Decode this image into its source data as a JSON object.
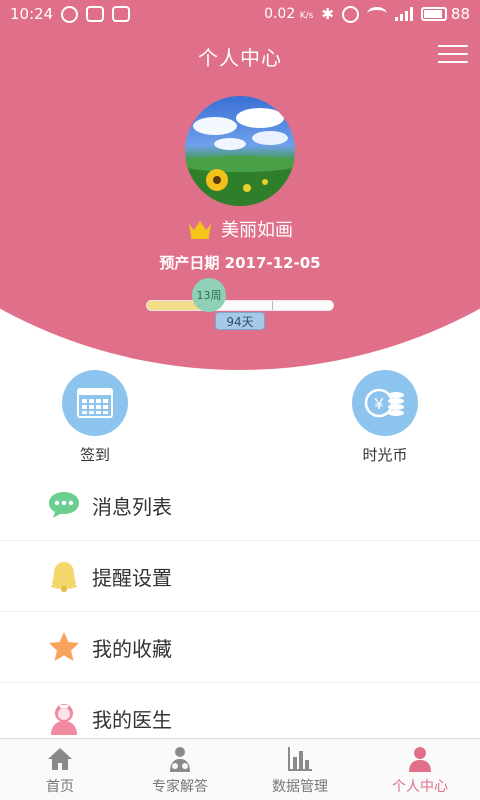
{
  "status_bar": {
    "time": "10:24",
    "network_speed": "0.02",
    "network_unit": "K/s",
    "battery": "88"
  },
  "header": {
    "title": "个人中心",
    "menu_icon": "hamburger-menu-icon"
  },
  "profile": {
    "username": "美丽如画",
    "due_date": "预产日期 2017-12-05",
    "pregnancy_week": "13周",
    "days_tag": "94天",
    "progress_fraction": 0.35,
    "colors": {
      "header": "#e0708a",
      "accent": "#e0708a"
    }
  },
  "quick_actions": [
    {
      "label": "签到",
      "icon": "calendar-icon"
    },
    {
      "label": "时光币",
      "icon": "coins-icon"
    }
  ],
  "menu_items": [
    {
      "label": "消息列表",
      "icon": "chat-bubble-icon"
    },
    {
      "label": "提醒设置",
      "icon": "bell-icon"
    },
    {
      "label": "我的收藏",
      "icon": "star-icon"
    },
    {
      "label": "我的医生",
      "icon": "doctor-icon"
    }
  ],
  "tab_bar": [
    {
      "label": "首页",
      "icon": "home-icon",
      "active": false
    },
    {
      "label": "专家解答",
      "icon": "stethoscope-icon",
      "active": false
    },
    {
      "label": "数据管理",
      "icon": "bar-chart-icon",
      "active": false
    },
    {
      "label": "个人中心",
      "icon": "person-icon",
      "active": true
    }
  ]
}
